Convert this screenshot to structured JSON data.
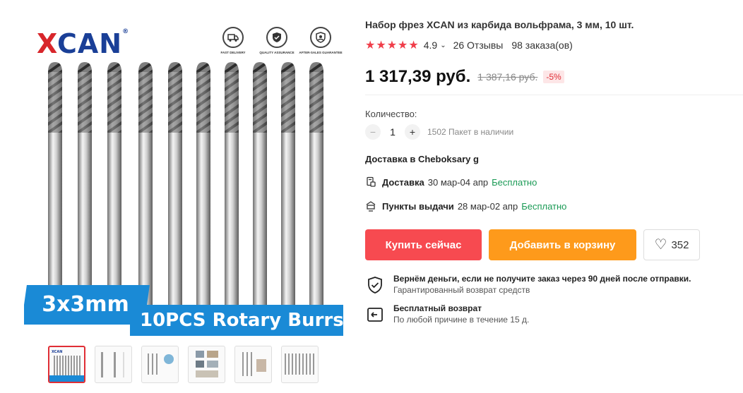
{
  "gallery": {
    "brand": "XCAN",
    "brand_mark": "®",
    "badges": [
      "FAST DELIVERY",
      "QUALITY ASSURANCE",
      "AFTER-SALES GUARANTEE"
    ],
    "size_label": "3x3mm",
    "caption": "10PCS Rotary Burrs",
    "thumbnail_count": 6,
    "active_thumbnail": 1
  },
  "product": {
    "title": "Набор фрез XCAN из карбида вольфрама, 3 мм, 10 шт.",
    "rating": "4.9",
    "star_count": 5,
    "reviews": "26 Отзывы",
    "orders": "98 заказа(ов)",
    "price": "1 317,39 руб.",
    "old_price": "1 387,16 руб.",
    "discount": "-5%"
  },
  "quantity": {
    "label": "Количество:",
    "value": "1",
    "minus": "−",
    "plus": "+",
    "stock": "1502 Пакет в наличии"
  },
  "shipping": {
    "destination": "Доставка в Cheboksary g",
    "delivery_label": "Доставка",
    "delivery_dates": "30 мар-04 апр",
    "delivery_price": "Бесплатно",
    "pickup_label": "Пункты выдачи",
    "pickup_dates": "28 мар-02 апр",
    "pickup_price": "Бесплатно"
  },
  "actions": {
    "buy_now": "Купить сейчас",
    "add_to_cart": "Добавить в корзину",
    "wishlist_count": "352"
  },
  "guarantees": {
    "refund_title": "Вернём деньги, если не получите заказ через 90 дней после отправки.",
    "refund_sub": "Гарантированный возврат средств",
    "return_title": "Бесплатный возврат",
    "return_sub": "По любой причине в течение 15 д."
  },
  "colors": {
    "accent_red": "#f74a50",
    "accent_orange": "#fe9a1b",
    "star": "#f03e4a",
    "free": "#1a9a55",
    "banner_blue": "#1a8ad6",
    "brand_blue": "#1a3f97"
  },
  "icons": {
    "badge_1": "truck-icon",
    "badge_2": "shield-check-icon",
    "badge_3": "support-icon",
    "delivery": "courier-icon",
    "pickup": "pickup-point-icon",
    "wishlist": "heart-icon",
    "refund": "shield-check-icon",
    "return": "return-arrow-icon"
  }
}
